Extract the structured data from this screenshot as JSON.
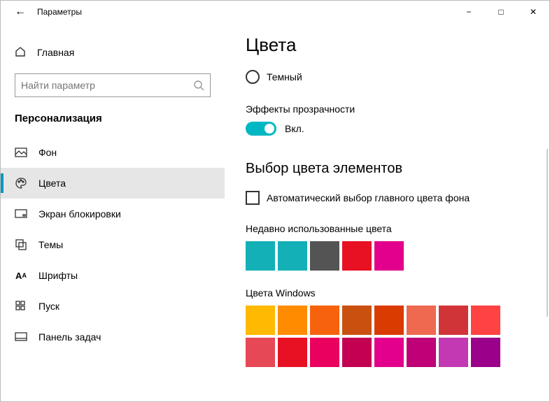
{
  "window": {
    "title": "Параметры"
  },
  "sidebar": {
    "home": "Главная",
    "search_placeholder": "Найти параметр",
    "category": "Персонализация",
    "items": [
      {
        "label": "Фон"
      },
      {
        "label": "Цвета"
      },
      {
        "label": "Экран блокировки"
      },
      {
        "label": "Темы"
      },
      {
        "label": "Шрифты"
      },
      {
        "label": "Пуск"
      },
      {
        "label": "Панель задач"
      }
    ]
  },
  "page": {
    "title": "Цвета",
    "mode_option": "Темный",
    "transparency_label": "Эффекты прозрачности",
    "transparency_state": "Вкл.",
    "accent_heading": "Выбор цвета элементов",
    "auto_pick_label": "Автоматический выбор главного цвета фона",
    "recent_label": "Недавно использованные цвета",
    "recent_colors": [
      "#14b0b8",
      "#14b0b8",
      "#545454",
      "#e81123",
      "#e3008c"
    ],
    "windows_label": "Цвета Windows",
    "windows_rows": [
      [
        "#ffb900",
        "#ff8c00",
        "#f7630c",
        "#ca5010",
        "#da3b01",
        "#ef6950",
        "#d13438",
        "#ff4343"
      ],
      [
        "#e74856",
        "#e81123",
        "#ea005e",
        "#c30052",
        "#e3008c",
        "#bf0077",
        "#c239b3",
        "#9a0089"
      ]
    ]
  }
}
